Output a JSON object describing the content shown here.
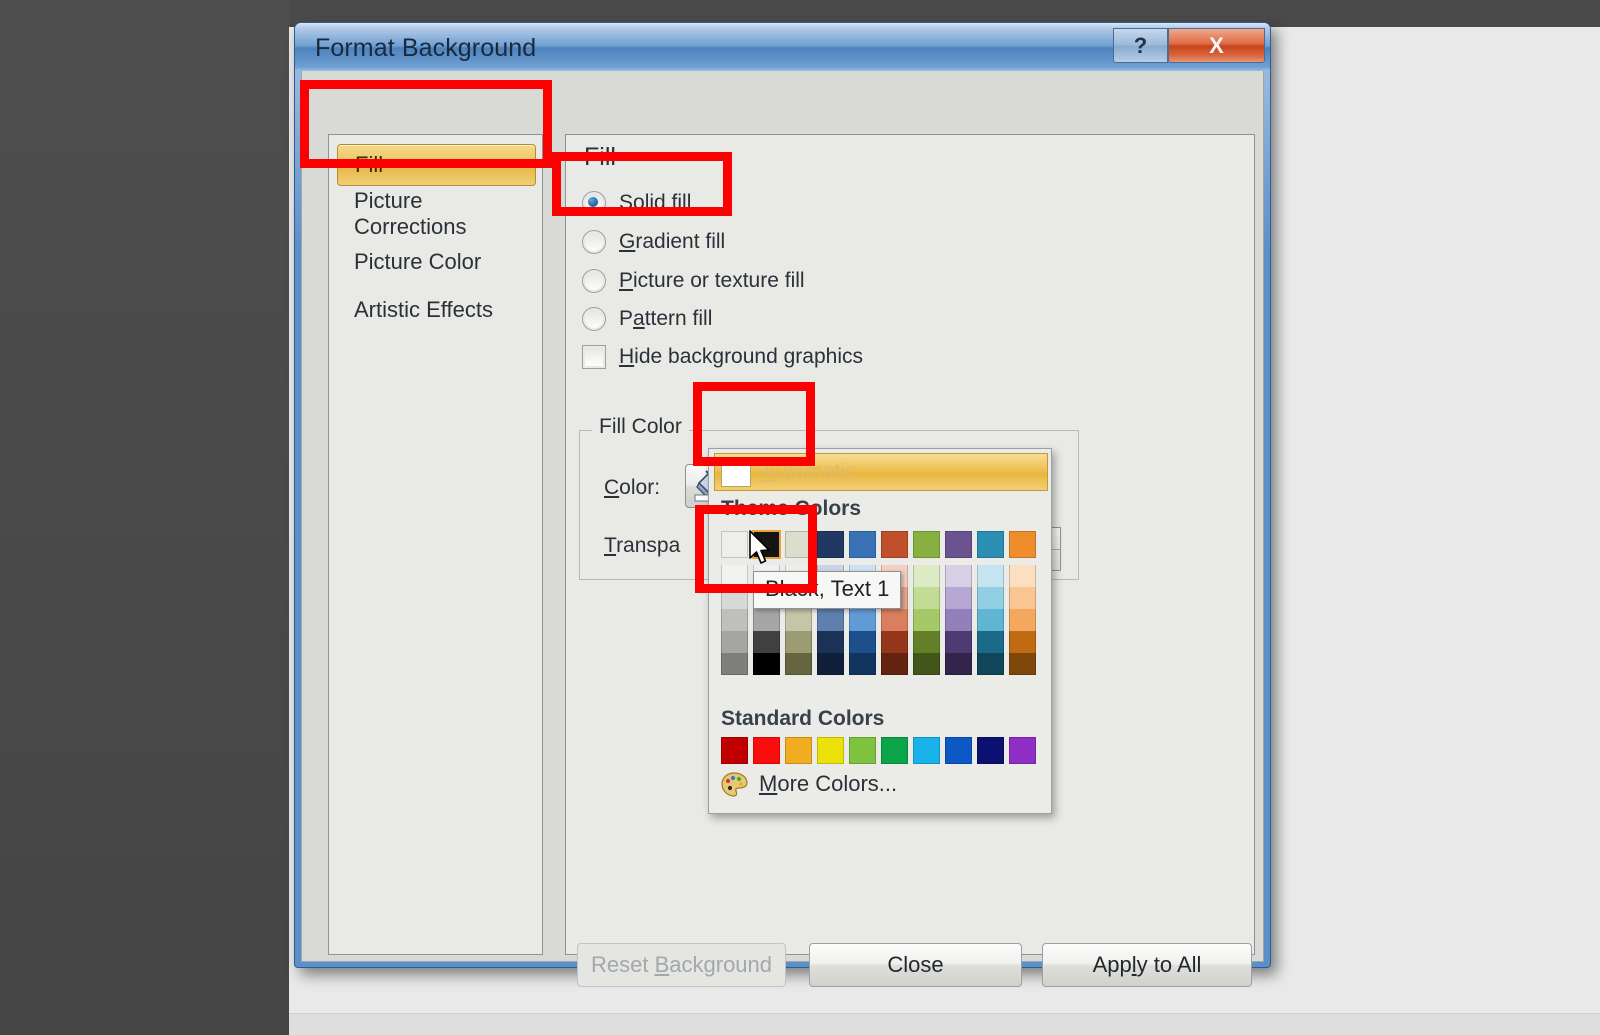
{
  "window": {
    "title": "Format Background",
    "help_button": "?",
    "close_button": "X"
  },
  "sidebar": {
    "items": [
      {
        "label": "Fill",
        "selected": true
      },
      {
        "label": "Picture Corrections",
        "selected": false
      },
      {
        "label": "Picture Color",
        "selected": false
      },
      {
        "label": "Artistic Effects",
        "selected": false
      }
    ]
  },
  "fill_pane": {
    "heading": "Fill",
    "options": [
      {
        "label": "Solid fill",
        "accel": "S",
        "type": "radio",
        "checked": true
      },
      {
        "label": "Gradient fill",
        "accel": "G",
        "type": "radio",
        "checked": false
      },
      {
        "label": "Picture or texture fill",
        "accel": "P",
        "type": "radio",
        "checked": false
      },
      {
        "label": "Pattern fill",
        "accel": "a",
        "type": "radio",
        "checked": false
      },
      {
        "label": "Hide background graphics",
        "accel": "H",
        "type": "checkbox",
        "checked": false
      }
    ],
    "fill_color_group": {
      "legend": "Fill Color",
      "color_label": "Color:",
      "color_accel": "C",
      "transparency_label": "Transpa",
      "transparency_label_full": "Transparency:",
      "transparency_accel": "T",
      "color_button_icon": "paint-bucket-icon",
      "color_button_swatch": "#ffffff"
    }
  },
  "color_dropdown": {
    "automatic_label": "Automatic",
    "automatic_accel": "A",
    "theme_header": "Theme Colors",
    "standard_header": "Standard Colors",
    "more_colors_label": "More Colors...",
    "more_colors_accel": "M",
    "theme_colors": [
      {
        "name": "White, Background 1",
        "base": "#eeeeec",
        "variants": [
          "#f2f2f0",
          "#d8d8d6",
          "#bfbfbd",
          "#a5a5a3",
          "#7f7f7d"
        ]
      },
      {
        "name": "Black, Text 1",
        "base": "#151515",
        "hovered": true,
        "variants": [
          "#f0f0f0",
          "#d0d0d0",
          "#a6a6a6",
          "#404040",
          "#000000"
        ]
      },
      {
        "name": "Tan, Background 2",
        "base": "#ddddce",
        "variants": [
          "#eeeee4",
          "#dedecb",
          "#c5c5a8",
          "#9c9c74",
          "#656540"
        ]
      },
      {
        "name": "Dark Blue, Text 2",
        "base": "#1f3864",
        "variants": [
          "#c9d4e6",
          "#94aacc",
          "#5f7fae",
          "#1c3257",
          "#0f1f3a"
        ]
      },
      {
        "name": "Blue, Accent 1",
        "base": "#3a72b8",
        "variants": [
          "#cfe0f2",
          "#9cc1e6",
          "#629ad6",
          "#1c4f8c",
          "#11355e"
        ]
      },
      {
        "name": "Red, Accent 2",
        "base": "#c0502c",
        "variants": [
          "#f3cfc2",
          "#e6a690",
          "#d97f5e",
          "#93361a",
          "#632310"
        ]
      },
      {
        "name": "Olive Green, Accent 3",
        "base": "#88b040",
        "variants": [
          "#dcebc3",
          "#c2dc96",
          "#a4c966",
          "#638029",
          "#42561a"
        ]
      },
      {
        "name": "Purple, Accent 4",
        "base": "#6b5391",
        "variants": [
          "#d7cfe6",
          "#b6a7d3",
          "#9280bb",
          "#4f3a73",
          "#33244d"
        ]
      },
      {
        "name": "Aqua, Accent 5",
        "base": "#2a8fb3",
        "variants": [
          "#c4e4ef",
          "#93cfe2",
          "#5fb5d2",
          "#1b6a87",
          "#11455a"
        ]
      },
      {
        "name": "Orange, Accent 6",
        "base": "#ef8c2b",
        "variants": [
          "#fcdfc0",
          "#f8c593",
          "#f4a85f",
          "#c06a12",
          "#80470b"
        ]
      }
    ],
    "standard_colors": [
      {
        "name": "Dark Red",
        "hex": "#c00000"
      },
      {
        "name": "Red",
        "hex": "#fc0d0d"
      },
      {
        "name": "Orange",
        "hex": "#f2ac1f"
      },
      {
        "name": "Yellow",
        "hex": "#eae209"
      },
      {
        "name": "Light Green",
        "hex": "#7ec33f"
      },
      {
        "name": "Green",
        "hex": "#0aa548"
      },
      {
        "name": "Light Blue",
        "hex": "#19b3ec"
      },
      {
        "name": "Blue",
        "hex": "#0b58c6"
      },
      {
        "name": "Dark Blue",
        "hex": "#0d1073"
      },
      {
        "name": "Purple",
        "hex": "#8e2ec4"
      }
    ]
  },
  "tooltip": {
    "text": "Black, Text 1"
  },
  "footer": {
    "reset_background": "Reset Background",
    "reset_background_accel": "B",
    "reset_background_disabled": true,
    "close": "Close",
    "apply_to_all": "Apply to All",
    "apply_to_all_accel": "l"
  },
  "annotations": {
    "accent_color": "#fb0202",
    "boxes": [
      {
        "name": "fill-nav-item"
      },
      {
        "name": "solid-fill-option"
      },
      {
        "name": "color-dropdown-button"
      },
      {
        "name": "black-text-1-swatch"
      }
    ]
  }
}
